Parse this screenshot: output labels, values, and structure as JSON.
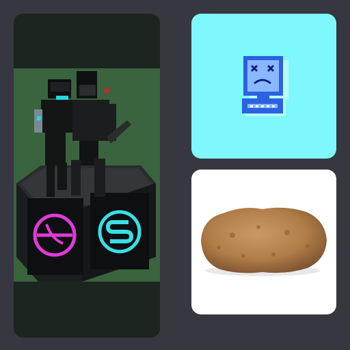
{
  "gallery": {
    "items": [
      {
        "id": "voxel-figures-on-pedestal",
        "icons": [
          "sphere-logo-icon",
          "s-coin-logo-icon"
        ],
        "colors": {
          "background": "#1d2521",
          "scene": "#3e6a40",
          "logo_magenta": "#e13ad8",
          "logo_cyan": "#39dfe6"
        }
      },
      {
        "id": "sad-computer",
        "icons": [
          "sad-computer-icon"
        ],
        "colors": {
          "background": "#7ef7fd",
          "monitor": "#2b62e0",
          "screen": "#8ab8ff"
        }
      },
      {
        "id": "potato",
        "icons": [
          "potato-icon"
        ],
        "colors": {
          "background": "#ffffff",
          "potato": "#b07d48"
        }
      }
    ]
  }
}
